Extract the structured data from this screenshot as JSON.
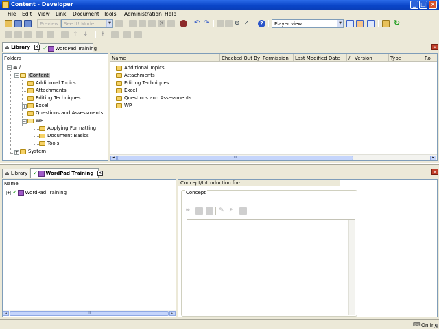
{
  "window": {
    "title": "Content - Developer"
  },
  "window_controls": {
    "minimize": "_",
    "maximize": "□",
    "close": "×"
  },
  "menubar": [
    "File",
    "Edit",
    "View",
    "Link",
    "Document",
    "Tools",
    "Administration",
    "Help"
  ],
  "toolbar": {
    "preview_label": "Preview",
    "mode_select": "See It! Mode",
    "view_select": "Player view"
  },
  "top_panel": {
    "tabs": [
      {
        "label": "Library",
        "active": true
      },
      {
        "label": "WordPad Training",
        "active": false
      }
    ],
    "folders_header": "Folders",
    "tree": {
      "root": "/",
      "content": "Content",
      "children": [
        "Additional Topics",
        "Attachments",
        "Editing Techniques",
        "Excel",
        "Questions and Assessments",
        "WP"
      ],
      "wp_children": [
        "Applying Formatting",
        "Document Basics",
        "Tools"
      ],
      "system": "System"
    },
    "columns": [
      "Name",
      "Checked Out By",
      "Permission",
      "Last Modified Date",
      "/",
      "Version",
      "Type",
      "Ro"
    ],
    "files": [
      "Additional Topics",
      "Attachments",
      "Editing Techniques",
      "Excel",
      "Questions and Assessments",
      "WP"
    ],
    "scroll_grip": "III"
  },
  "bottom_panel": {
    "tabs": [
      {
        "label": "Library",
        "active": false
      },
      {
        "label": "WordPad Training",
        "active": true
      }
    ],
    "name_header": "Name",
    "outline_item": "WordPad Training",
    "concept_header": "Concept/Introduction for:",
    "concept_group": "Concept",
    "scroll_grip": "III"
  },
  "status": {
    "online": "Online"
  }
}
